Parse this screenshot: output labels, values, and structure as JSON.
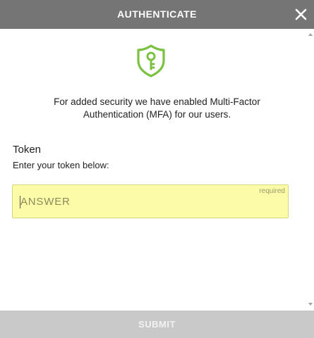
{
  "header": {
    "title": "AUTHENTICATE",
    "close_icon": "close-icon"
  },
  "content": {
    "icon": "shield-key-icon",
    "icon_color": "#7cc242",
    "description_line1": "For added security we have enabled Multi-Factor",
    "description_line2": "Authentication (MFA) for our users.",
    "token_label": "Token",
    "token_help": "Enter your token below:",
    "answer_placeholder": "ANSWER",
    "required_label": "required",
    "field_color": "#fbfba8"
  },
  "footer": {
    "submit_label": "SUBMIT"
  }
}
